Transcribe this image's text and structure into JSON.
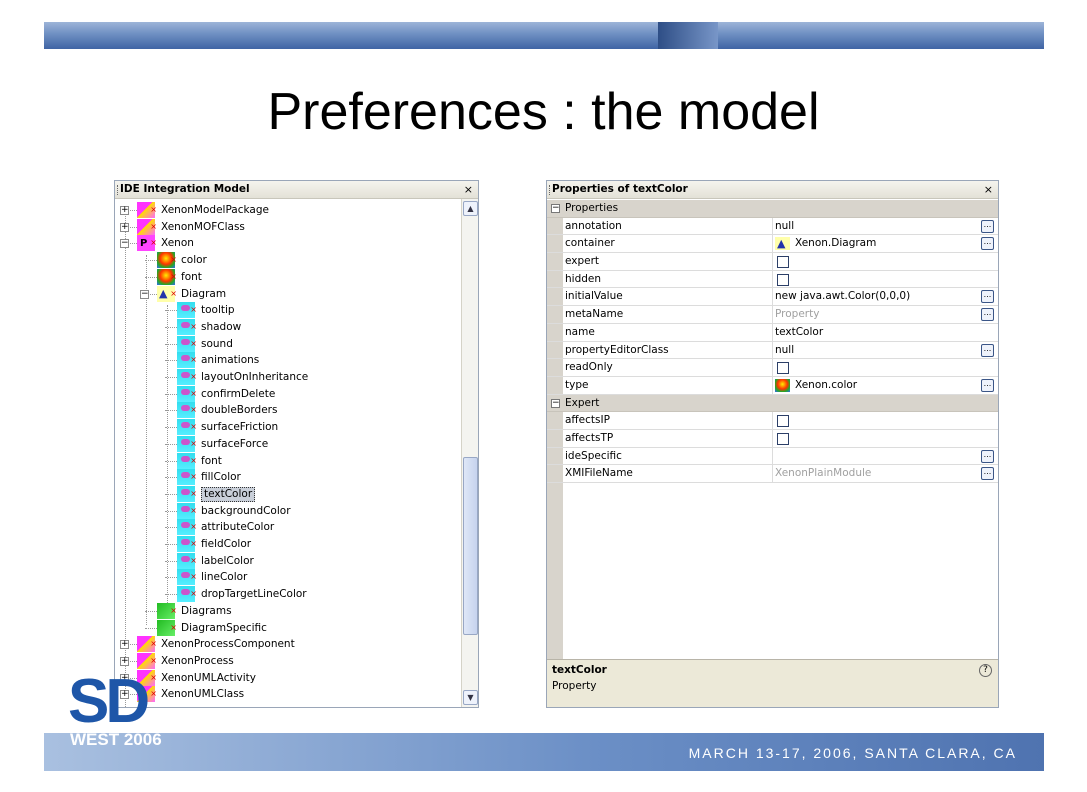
{
  "slide": {
    "title": "Preferences : the model",
    "footer": "MARCH 13-17, 2006, SANTA CLARA, CA",
    "logo_sd": "SD",
    "logo_west": "WEST 2006"
  },
  "tree_window": {
    "title": "IDE Integration Model",
    "close": "×",
    "rows": [
      {
        "label": "XenonModelPackage",
        "icon": "model-package-icon"
      },
      {
        "label": "XenonMOFClass",
        "icon": "model-package-icon"
      },
      {
        "label": "Xenon",
        "icon": "package-icon"
      },
      {
        "label": "color",
        "icon": "color-type-icon"
      },
      {
        "label": "font",
        "icon": "color-type-icon"
      },
      {
        "label": "Diagram",
        "icon": "diagram-icon"
      },
      {
        "label": "tooltip",
        "icon": "property-icon"
      },
      {
        "label": "shadow",
        "icon": "property-icon"
      },
      {
        "label": "sound",
        "icon": "property-icon"
      },
      {
        "label": "animations",
        "icon": "property-icon"
      },
      {
        "label": "layoutOnInheritance",
        "icon": "property-icon"
      },
      {
        "label": "confirmDelete",
        "icon": "property-icon"
      },
      {
        "label": "doubleBorders",
        "icon": "property-icon"
      },
      {
        "label": "surfaceFriction",
        "icon": "property-icon"
      },
      {
        "label": "surfaceForce",
        "icon": "property-icon"
      },
      {
        "label": "font",
        "icon": "property-icon"
      },
      {
        "label": "fillColor",
        "icon": "property-icon"
      },
      {
        "label": "textColor",
        "icon": "property-icon"
      },
      {
        "label": "backgroundColor",
        "icon": "property-icon"
      },
      {
        "label": "attributeColor",
        "icon": "property-icon"
      },
      {
        "label": "fieldColor",
        "icon": "property-icon"
      },
      {
        "label": "labelColor",
        "icon": "property-icon"
      },
      {
        "label": "lineColor",
        "icon": "property-icon"
      },
      {
        "label": "dropTargetLineColor",
        "icon": "property-icon"
      },
      {
        "label": "Diagrams",
        "icon": "diagrams-icon"
      },
      {
        "label": "DiagramSpecific",
        "icon": "diagrams-icon"
      },
      {
        "label": "XenonProcessComponent",
        "icon": "model-package-icon"
      },
      {
        "label": "XenonProcess",
        "icon": "model-package-icon"
      },
      {
        "label": "XenonUMLActivity",
        "icon": "model-package-icon"
      },
      {
        "label": "XenonUMLClass",
        "icon": "model-package-icon"
      }
    ],
    "selected": "textColor"
  },
  "properties_window": {
    "title": "Properties of textColor",
    "close": "×",
    "categories": [
      {
        "label": "Properties",
        "toggle": "⊟",
        "rows": [
          {
            "name": "annotation",
            "value": "null",
            "kind": "text",
            "button": true
          },
          {
            "name": "container",
            "value": "Xenon.Diagram",
            "kind": "icon-text",
            "icon": "diagram-icon",
            "button": true
          },
          {
            "name": "expert",
            "value": "",
            "kind": "checkbox",
            "checked": false,
            "button": false
          },
          {
            "name": "hidden",
            "value": "",
            "kind": "checkbox",
            "checked": false,
            "button": false
          },
          {
            "name": "initialValue",
            "value": "new java.awt.Color(0,0,0)",
            "kind": "text",
            "button": true
          },
          {
            "name": "metaName",
            "value": "Property",
            "kind": "gray",
            "button": true
          },
          {
            "name": "name",
            "value": "textColor",
            "kind": "text",
            "button": false
          },
          {
            "name": "propertyEditorClass",
            "value": "null",
            "kind": "text",
            "button": true
          },
          {
            "name": "readOnly",
            "value": "",
            "kind": "checkbox",
            "checked": false,
            "button": false
          },
          {
            "name": "type",
            "value": "Xenon.color",
            "kind": "icon-text",
            "icon": "color-type-icon",
            "button": true
          }
        ]
      },
      {
        "label": "Expert",
        "toggle": "⊟",
        "rows": [
          {
            "name": "affectsIP",
            "value": "",
            "kind": "checkbox",
            "checked": false,
            "button": false
          },
          {
            "name": "affectsTP",
            "value": "",
            "kind": "checkbox",
            "checked": false,
            "button": false
          },
          {
            "name": "ideSpecific",
            "value": "",
            "kind": "text",
            "button": true
          },
          {
            "name": "XMIFileName",
            "value": "XenonPlainModule",
            "kind": "gray",
            "button": true
          }
        ]
      }
    ],
    "description": {
      "title": "textColor",
      "text": "Property",
      "help": "?"
    },
    "button_label": "..."
  }
}
